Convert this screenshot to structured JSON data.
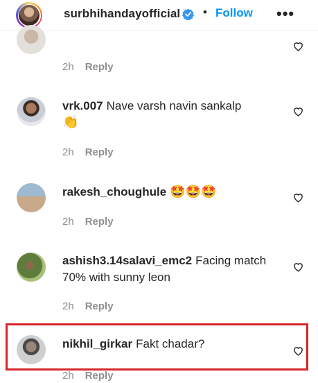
{
  "header": {
    "username": "surbhihandayofficial",
    "verified_icon": "verified-badge-icon",
    "separator": "•",
    "follow_label": "Follow",
    "more_label": "•••"
  },
  "colors": {
    "follow": "#0095f6",
    "meta": "#8e8e8e",
    "highlight": "#d8232a",
    "text": "#262626"
  },
  "comments": [
    {
      "username": "",
      "text": "",
      "time": "2h",
      "reply": "Reply"
    },
    {
      "username": "vrk.007",
      "text": "Nave varsh navin sankalp",
      "emoji": "👏",
      "time": "2h",
      "reply": "Reply"
    },
    {
      "username": "rakesh_choughule",
      "text": "",
      "emoji": "🤩🤩🤩",
      "time": "2h",
      "reply": "Reply"
    },
    {
      "username": "ashish3.14salavi_emc2",
      "text": "Facing match 70% with sunny leon",
      "time": "2h",
      "reply": "Reply"
    },
    {
      "username": "nikhil_girkar",
      "text": "Fakt chadar?",
      "time": "2h",
      "reply": "Reply"
    }
  ]
}
